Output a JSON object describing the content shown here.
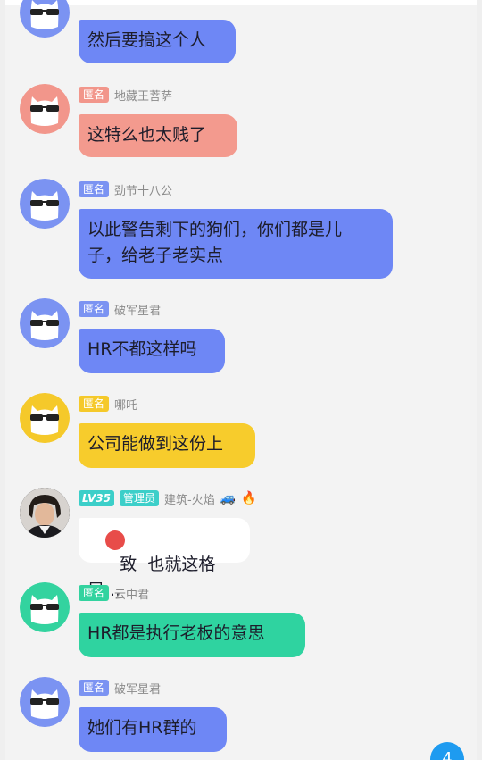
{
  "messages": [
    {
      "tag": "",
      "name": "",
      "text": "然后要搞这个人",
      "color": "#6e87f5",
      "avatar_color": "#7b93f2"
    },
    {
      "tag": "匿名",
      "name": "地藏王菩萨",
      "text": "这特么也太贱了",
      "color": "#f39a8e",
      "avatar_color": "#f2968b"
    },
    {
      "tag": "匿名",
      "name": "劲节十八公",
      "text": "以此警告剩下的狗们，你们都是儿\n子，给老子老实点",
      "color": "#6e87f5",
      "avatar_color": "#7b93f2"
    },
    {
      "tag": "匿名",
      "name": "破军星君",
      "text": "HR不都这样吗",
      "color": "#6e87f5",
      "avatar_color": "#7b93f2"
    },
    {
      "tag": "匿名",
      "name": "哪吒",
      "text": "公司能做到这份上",
      "color": "#f7cc2c",
      "avatar_color": "#f5c92a"
    },
    {
      "level": "LV35",
      "role": "管理员",
      "name": "建筑-火焰",
      "text": "致  也就这格局...",
      "color": "#ffffff"
    },
    {
      "tag": "匿名",
      "name": "云中君",
      "text": "HR都是执行老板的意思",
      "color": "#2fd3a0",
      "avatar_color": "#33d39f"
    },
    {
      "tag": "匿名",
      "name": "破军星君",
      "text": "她们有HR群的",
      "color": "#6e87f5",
      "avatar_color": "#7b93f2"
    }
  ],
  "icons": {
    "anon_avatar": "sunglasses-cat-icon",
    "user_avatar": "user-photo-avatar",
    "badge1": "car-icon",
    "badge2": "fire-icon",
    "fab": "scroll-down-icon"
  },
  "fab_label": "4"
}
